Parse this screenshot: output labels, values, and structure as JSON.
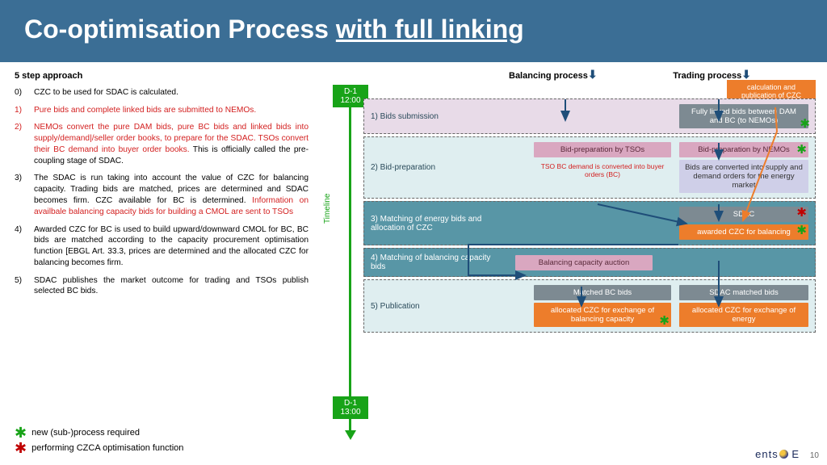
{
  "title_a": "Co-optimisation Process ",
  "title_b": "with full linking",
  "col_balancing": "Balancing process",
  "col_trading": "Trading process",
  "left": {
    "heading": "5 step approach",
    "s0": {
      "n": "0)",
      "t": "CZC to be used for SDAC is calculated."
    },
    "s1": {
      "n": "1)",
      "t": "Pure bids and complete linked bids are submitted to NEMOs."
    },
    "s2": {
      "n": "2)",
      "a": "NEMOs convert the pure DAM bids, pure BC bids and linked bids into supply/demand|/seller order books, to prepare for the SDAC. TSOs convert their BC demand into buyer order books.",
      "b": " This is officially called the pre-coupling stage of SDAC."
    },
    "s3": {
      "n": "3)",
      "a": "The SDAC is run taking into account the value of CZC for balancing capacity. Trading bids are matched, prices are determined and SDAC becomes firm. CZC available for BC is determined. ",
      "b": "Information on availbale balancing capacity bids for building a CMOL are sent to TSOs"
    },
    "s4": {
      "n": "4)",
      "t": "Awarded CZC for BC is used to build upward/downward CMOL for BC, BC bids are matched according to the capacity procurement optimisation function [EBGL Art. 33.3, prices are determined and the allocated CZC for balancing becomes firm."
    },
    "s5": {
      "n": "5)",
      "t": "SDAC publishes the market outcome for trading and TSOs publish selected BC bids."
    }
  },
  "timeline": {
    "label": "Timeline",
    "top": "D-1\n12:00",
    "bot": "D-1\n13:00"
  },
  "czc_box": "calculation and publication of CZC",
  "rows": {
    "r1": {
      "label": "1)   Bids submission",
      "c1": "Fully linked bids between DAM and BC (to NEMOs)"
    },
    "r2": {
      "label": "2) Bid-preparation",
      "c1": "Bid-preparation by TSOs",
      "c1b": "TSO BC demand is converted into buyer orders (BC)",
      "c2": "Bid-preparation by NEMOs",
      "c2b": "Bids are converted into supply and demand orders for the energy market"
    },
    "r3": {
      "label": "3) Matching of energy bids and allocation of CZC",
      "c1": "SDAC",
      "c1b": "awarded CZC for balancing"
    },
    "r4": {
      "label": "4) Matching of balancing capacity bids",
      "c1": "Balancing capacity auction"
    },
    "r5": {
      "label": "5) Publication",
      "c1": "Matched BC bids",
      "c1b": "allocated CZC for exchange of balancing capacity",
      "c2": "SDAC matched bids",
      "c2b": "allocated CZC for exchange of energy"
    }
  },
  "legend": {
    "a": "new (sub-)process required",
    "b": "performing CZCA optimisation function"
  },
  "slide_num": "10",
  "logo": "ents"
}
